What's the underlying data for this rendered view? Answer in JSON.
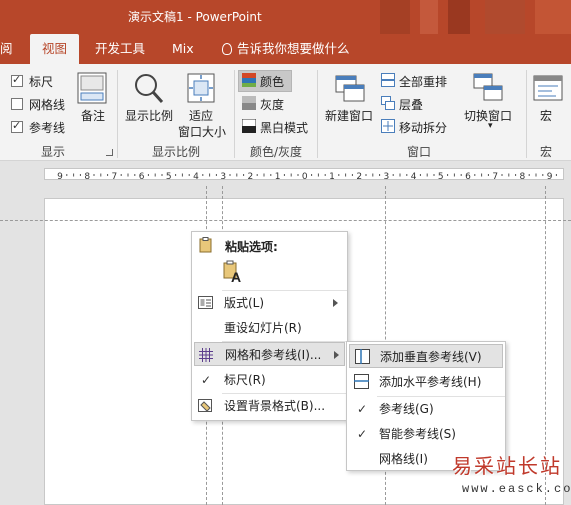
{
  "window": {
    "title": "演示文稿1  -  PowerPoint"
  },
  "tabs": [
    {
      "label": "阅"
    },
    {
      "label": "视图",
      "active": true
    },
    {
      "label": "开发工具"
    },
    {
      "label": "Mix"
    }
  ],
  "tell_me": "告诉我你想要做什么",
  "ribbon": {
    "show": {
      "ruler": "标尺",
      "ruler_checked": true,
      "gridlines": "网格线",
      "gridlines_checked": false,
      "guides": "参考线",
      "guides_checked": true,
      "notes": "备注",
      "group": "显示"
    },
    "zoom": {
      "zoom": "显示比例",
      "fit_line1": "适应",
      "fit_line2": "窗口大小",
      "group": "显示比例"
    },
    "color": {
      "color": "颜色",
      "grayscale": "灰度",
      "bw": "黑白模式",
      "group": "颜色/灰度"
    },
    "window": {
      "new": "新建窗口",
      "arrange": "全部重排",
      "cascade": "层叠",
      "move_split": "移动拆分",
      "switch": "切换窗口",
      "group": "窗口"
    },
    "macros": {
      "macros": "宏",
      "group": "宏"
    }
  },
  "ruler": {
    "labels": [
      "9",
      "8",
      "7",
      "6",
      "5",
      "4",
      "3",
      "2",
      "1",
      "0",
      "1",
      "2",
      "3",
      "4",
      "5",
      "6",
      "7",
      "8",
      "9"
    ]
  },
  "context_menu": {
    "paste_header": "粘贴选项:",
    "layout": "版式(L)",
    "reset_slide": "重设幻灯片(R)",
    "grid_guides": "网格和参考线(I)...",
    "ruler": "标尺(R)",
    "format_bg": "设置背景格式(B)..."
  },
  "submenu": {
    "add_vertical": "添加垂直参考线(V)",
    "add_horizontal": "添加水平参考线(H)",
    "guides": "参考线(G)",
    "smart_guides": "智能参考线(S)",
    "gridlines": "网格线(I)"
  },
  "watermark": {
    "text": "易采站长站",
    "url": "www.easck.com"
  },
  "colors": {
    "accent": "#b7472a",
    "ribbon": "#f3f3f3",
    "canvas": "#e3e3e3"
  }
}
